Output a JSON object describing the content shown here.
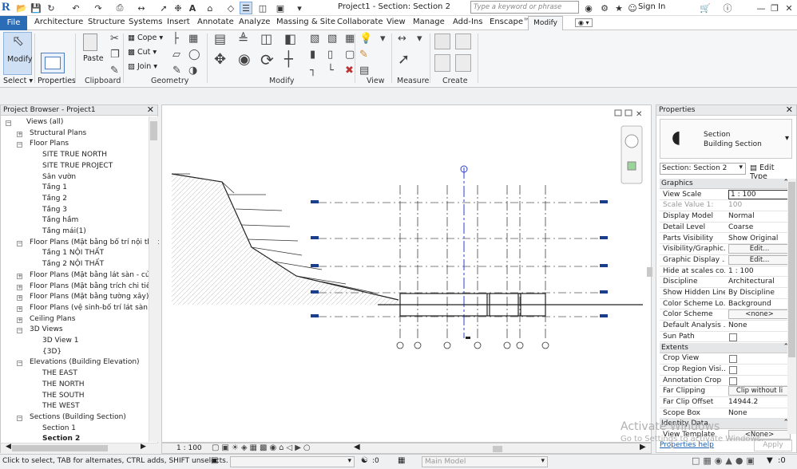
{
  "titlebar": {
    "logo": "R",
    "title": "Project1 - Section: Section 2",
    "search_placeholder": "Type a keyword or phrase",
    "signin": "Sign In"
  },
  "tabs": [
    "File",
    "Architecture",
    "Structure",
    "Systems",
    "Insert",
    "Annotate",
    "Analyze",
    "Massing & Site",
    "Collaborate",
    "View",
    "Manage",
    "Add-Ins",
    "Enscape™",
    "Modify"
  ],
  "ribbon": {
    "modify_label": "Modify",
    "select_label": "Select",
    "properties_label": "Properties",
    "paste_label": "Paste",
    "cope_label": "Cope",
    "cut_label": "Cut",
    "join_label": "Join",
    "panels": {
      "clipboard": "Clipboard",
      "geometry": "Geometry",
      "modify": "Modify",
      "view": "View",
      "measure": "Measure",
      "create": "Create"
    }
  },
  "browser": {
    "title": "Project Browser - Project1",
    "items": [
      {
        "label": "Views (all)",
        "level": 0,
        "toggle": "−"
      },
      {
        "label": "Structural Plans",
        "level": 1,
        "toggle": "+"
      },
      {
        "label": "Floor Plans",
        "level": 1,
        "toggle": "−"
      },
      {
        "label": "SITE TRUE NORTH",
        "level": 2,
        "toggle": ""
      },
      {
        "label": "SITE TRUE PROJECT",
        "level": 2,
        "toggle": ""
      },
      {
        "label": "Sân vườn",
        "level": 2,
        "toggle": ""
      },
      {
        "label": "Tầng 1",
        "level": 2,
        "toggle": ""
      },
      {
        "label": "Tầng 2",
        "level": 2,
        "toggle": ""
      },
      {
        "label": "Tầng 3",
        "level": 2,
        "toggle": ""
      },
      {
        "label": "Tầng hầm",
        "level": 2,
        "toggle": ""
      },
      {
        "label": "Tầng mái(1)",
        "level": 2,
        "toggle": ""
      },
      {
        "label": "Floor Plans (Mặt bằng bố trí nội thất",
        "level": 1,
        "toggle": "−"
      },
      {
        "label": "Tầng 1 NỘI THẤT",
        "level": 2,
        "toggle": ""
      },
      {
        "label": "Tầng 2 NỘI THẤT",
        "level": 2,
        "toggle": ""
      },
      {
        "label": "Floor Plans (Mặt bằng lát sàn - cửa)",
        "level": 1,
        "toggle": "+"
      },
      {
        "label": "Floor Plans (Mặt bằng trích chi tiết)",
        "level": 1,
        "toggle": "+"
      },
      {
        "label": "Floor Plans (Mặt bằng tường xây)",
        "level": 1,
        "toggle": "+"
      },
      {
        "label": "Floor Plans (vệ sinh-bố trí lát sàn)",
        "level": 1,
        "toggle": "+"
      },
      {
        "label": "Ceiling Plans",
        "level": 1,
        "toggle": "+"
      },
      {
        "label": "3D Views",
        "level": 1,
        "toggle": "−"
      },
      {
        "label": "3D View 1",
        "level": 2,
        "toggle": ""
      },
      {
        "label": "{3D}",
        "level": 2,
        "toggle": ""
      },
      {
        "label": "Elevations (Building Elevation)",
        "level": 1,
        "toggle": "−"
      },
      {
        "label": "THE EAST",
        "level": 2,
        "toggle": ""
      },
      {
        "label": "THE NORTH",
        "level": 2,
        "toggle": ""
      },
      {
        "label": "THE SOUTH",
        "level": 2,
        "toggle": ""
      },
      {
        "label": "THE WEST",
        "level": 2,
        "toggle": ""
      },
      {
        "label": "Sections (Building Section)",
        "level": 1,
        "toggle": "−"
      },
      {
        "label": "Section 1",
        "level": 2,
        "toggle": ""
      },
      {
        "label": "Section 2",
        "level": 2,
        "toggle": "",
        "bold": true
      }
    ]
  },
  "view_control": {
    "scale": "1 : 100"
  },
  "properties": {
    "title": "Properties",
    "type_line1": "Section",
    "type_line2": "Building Section",
    "instance_select": "Section: Section 2",
    "edit_type": "Edit Type",
    "sections": [
      {
        "name": "Graphics",
        "rows": [
          {
            "k": "View Scale",
            "v": "1 : 100",
            "kind": "input"
          },
          {
            "k": "Scale Value    1:",
            "v": "100",
            "kind": "gray"
          },
          {
            "k": "Display Model",
            "v": "Normal",
            "kind": "text"
          },
          {
            "k": "Detail Level",
            "v": "Coarse",
            "kind": "text"
          },
          {
            "k": "Parts Visibility",
            "v": "Show Original",
            "kind": "text"
          },
          {
            "k": "Visibility/Graphic...",
            "v": "Edit...",
            "kind": "button"
          },
          {
            "k": "Graphic Display ...",
            "v": "Edit...",
            "kind": "button"
          },
          {
            "k": "Hide at scales co...",
            "v": "1 : 100",
            "kind": "text"
          },
          {
            "k": "Discipline",
            "v": "Architectural",
            "kind": "text"
          },
          {
            "k": "Show Hidden Lines",
            "v": "By Discipline",
            "kind": "text"
          },
          {
            "k": "Color Scheme Lo...",
            "v": "Background",
            "kind": "text"
          },
          {
            "k": "Color Scheme",
            "v": "<none>",
            "kind": "button"
          },
          {
            "k": "Default Analysis ...",
            "v": "None",
            "kind": "text"
          },
          {
            "k": "Sun Path",
            "v": "",
            "kind": "checkbox"
          }
        ]
      },
      {
        "name": "Extents",
        "rows": [
          {
            "k": "Crop View",
            "v": "",
            "kind": "checkbox"
          },
          {
            "k": "Crop Region Visi...",
            "v": "",
            "kind": "checkbox"
          },
          {
            "k": "Annotation Crop",
            "v": "",
            "kind": "checkbox"
          },
          {
            "k": "Far Clipping",
            "v": "Clip without li",
            "kind": "button"
          },
          {
            "k": "Far Clip Offset",
            "v": "14944.2",
            "kind": "text"
          },
          {
            "k": "Scope Box",
            "v": "None",
            "kind": "text"
          }
        ]
      },
      {
        "name": "Identity Data",
        "rows": [
          {
            "k": "View Template",
            "v": "<None>",
            "kind": "button"
          }
        ]
      }
    ],
    "help": "Properties help",
    "apply": "Apply"
  },
  "status": {
    "message": "Click to select, TAB for alternates, CTRL adds, SHIFT unselects.",
    "zero": ":0",
    "model": "Main Model"
  },
  "watermark": {
    "line1": "Activate Windows",
    "line2": "Go to Settings to activate Windows."
  }
}
